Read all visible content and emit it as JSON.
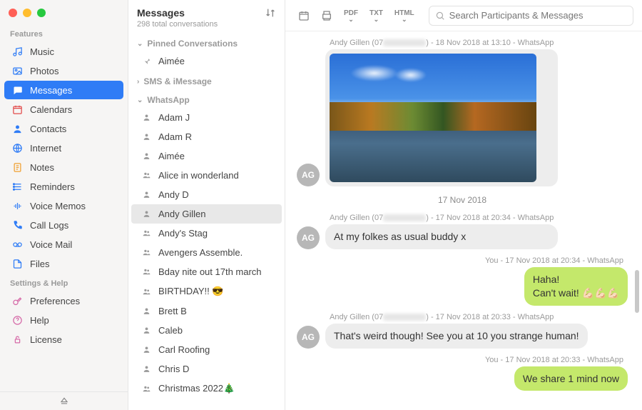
{
  "sidebar": {
    "sections": [
      {
        "label": "Features",
        "items": [
          {
            "icon": "music",
            "label": "Music"
          },
          {
            "icon": "photos",
            "label": "Photos"
          },
          {
            "icon": "messages",
            "label": "Messages",
            "selected": true
          },
          {
            "icon": "calendar",
            "label": "Calendars"
          },
          {
            "icon": "contacts",
            "label": "Contacts"
          },
          {
            "icon": "internet",
            "label": "Internet"
          },
          {
            "icon": "notes",
            "label": "Notes"
          },
          {
            "icon": "reminders",
            "label": "Reminders"
          },
          {
            "icon": "voicememos",
            "label": "Voice Memos"
          },
          {
            "icon": "calllogs",
            "label": "Call Logs"
          },
          {
            "icon": "voicemail",
            "label": "Voice Mail"
          },
          {
            "icon": "files",
            "label": "Files"
          }
        ]
      },
      {
        "label": "Settings & Help",
        "items": [
          {
            "icon": "prefs",
            "label": "Preferences"
          },
          {
            "icon": "help",
            "label": "Help"
          },
          {
            "icon": "license",
            "label": "License"
          }
        ]
      }
    ]
  },
  "conversations": {
    "title": "Messages",
    "subtitle": "298 total conversations",
    "groups": [
      {
        "name": "Pinned Conversations",
        "collapsed": false,
        "chevron": "down",
        "items": [
          {
            "icon": "pin",
            "name": "Aimée"
          }
        ]
      },
      {
        "name": "SMS & iMessage",
        "collapsed": true,
        "chevron": "right",
        "items": []
      },
      {
        "name": "WhatsApp",
        "collapsed": false,
        "chevron": "down",
        "items": [
          {
            "icon": "person",
            "name": "Adam J"
          },
          {
            "icon": "person",
            "name": "Adam R"
          },
          {
            "icon": "person",
            "name": "Aimée"
          },
          {
            "icon": "group",
            "name": "Alice in wonderland"
          },
          {
            "icon": "person",
            "name": "Andy D"
          },
          {
            "icon": "person",
            "name": "Andy Gillen",
            "selected": true
          },
          {
            "icon": "group",
            "name": "Andy's Stag"
          },
          {
            "icon": "group",
            "name": "Avengers Assemble."
          },
          {
            "icon": "group",
            "name": "Bday nite out 17th march"
          },
          {
            "icon": "group",
            "name": "BIRTHDAY!! 😎"
          },
          {
            "icon": "person",
            "name": "Brett B"
          },
          {
            "icon": "person",
            "name": "Caleb"
          },
          {
            "icon": "person",
            "name": "Carl Roofing"
          },
          {
            "icon": "person",
            "name": "Chris D"
          },
          {
            "icon": "group",
            "name": "Christmas 2022🎄"
          }
        ]
      }
    ]
  },
  "toolbar": {
    "exports": [
      "PDF",
      "TXT",
      "HTML"
    ],
    "search_placeholder": "Search Participants & Messages"
  },
  "thread": {
    "avatar_initials": "AG",
    "date_header": "17 Nov 2018",
    "messages": [
      {
        "kind": "image",
        "from": "other",
        "meta_prefix": "Andy Gillen (07",
        "meta_suffix": ") - 18 Nov 2018 at 13:10 - WhatsApp"
      },
      {
        "kind": "text",
        "from": "other",
        "meta_prefix": "Andy Gillen (07",
        "meta_suffix": ") - 17 Nov 2018 at 20:34 - WhatsApp",
        "body": "At my folkes as usual buddy x"
      },
      {
        "kind": "text",
        "from": "me",
        "meta": "You - 17 Nov 2018 at 20:34 - WhatsApp",
        "body": "Haha!\nCan't wait! 💪🏻💪🏻💪🏻"
      },
      {
        "kind": "text",
        "from": "other",
        "meta_prefix": "Andy Gillen (07",
        "meta_suffix": ") - 17 Nov 2018 at 20:33 - WhatsApp",
        "body": "That's weird though! See you at 10 you strange human!"
      },
      {
        "kind": "text",
        "from": "me",
        "meta": "You - 17 Nov 2018 at 20:33 - WhatsApp",
        "body": "We share 1 mind now"
      }
    ]
  }
}
